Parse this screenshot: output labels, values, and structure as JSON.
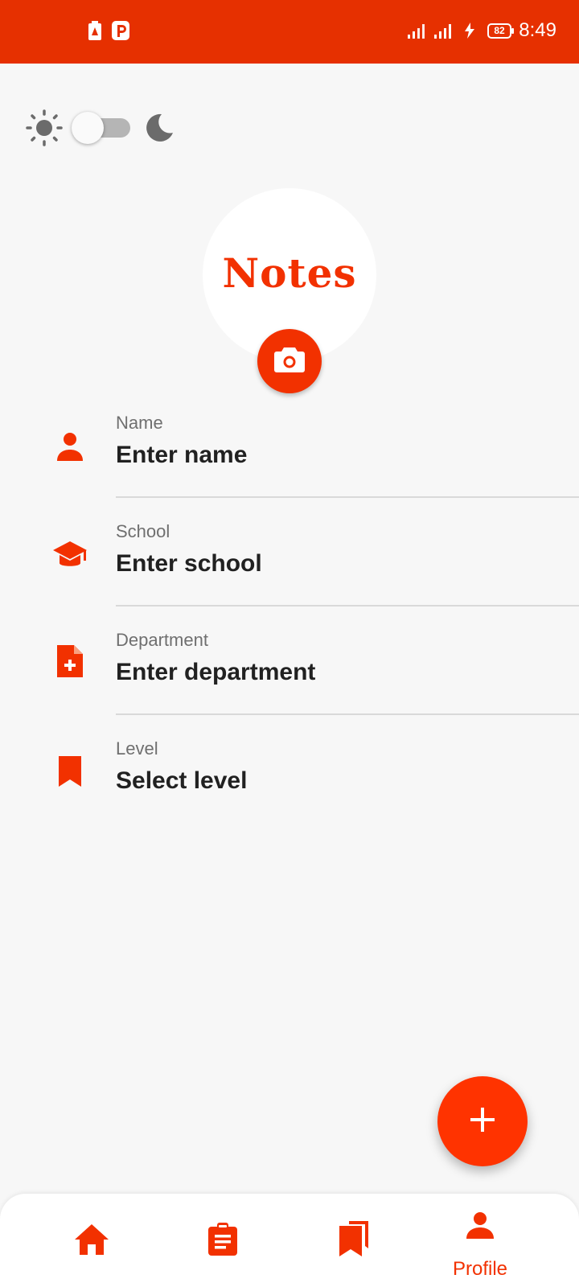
{
  "status_bar": {
    "time": "8:49",
    "battery_level": "82",
    "icons": [
      "battery-alert-icon",
      "parking-app-icon",
      "signal-icon",
      "signal-icon",
      "charging-icon",
      "battery-icon"
    ]
  },
  "theme_toggle": {
    "light_icon": "sun-icon",
    "dark_icon": "moon-icon",
    "is_dark": false
  },
  "profile": {
    "avatar_logo_text": "Notes",
    "camera_icon": "camera-icon"
  },
  "fields": [
    {
      "label": "Name",
      "value": "Enter name",
      "icon": "person-icon"
    },
    {
      "label": "School",
      "value": "Enter school",
      "icon": "graduation-cap-icon"
    },
    {
      "label": "Department",
      "value": "Enter department",
      "icon": "add-document-icon"
    },
    {
      "label": "Level",
      "value": "Select level",
      "icon": "bookmark-icon"
    }
  ],
  "fab": {
    "icon": "plus-icon"
  },
  "bottom_nav": {
    "items": [
      {
        "icon": "home-icon",
        "label": ""
      },
      {
        "icon": "clipboard-icon",
        "label": ""
      },
      {
        "icon": "bookmarks-icon",
        "label": ""
      },
      {
        "icon": "person-icon",
        "label": "Profile",
        "active": true
      }
    ]
  },
  "colors": {
    "accent": "#f23100",
    "status_bar": "#e63000",
    "background": "#f7f7f7",
    "text_primary": "#212121",
    "text_secondary": "#6f6f6f"
  }
}
